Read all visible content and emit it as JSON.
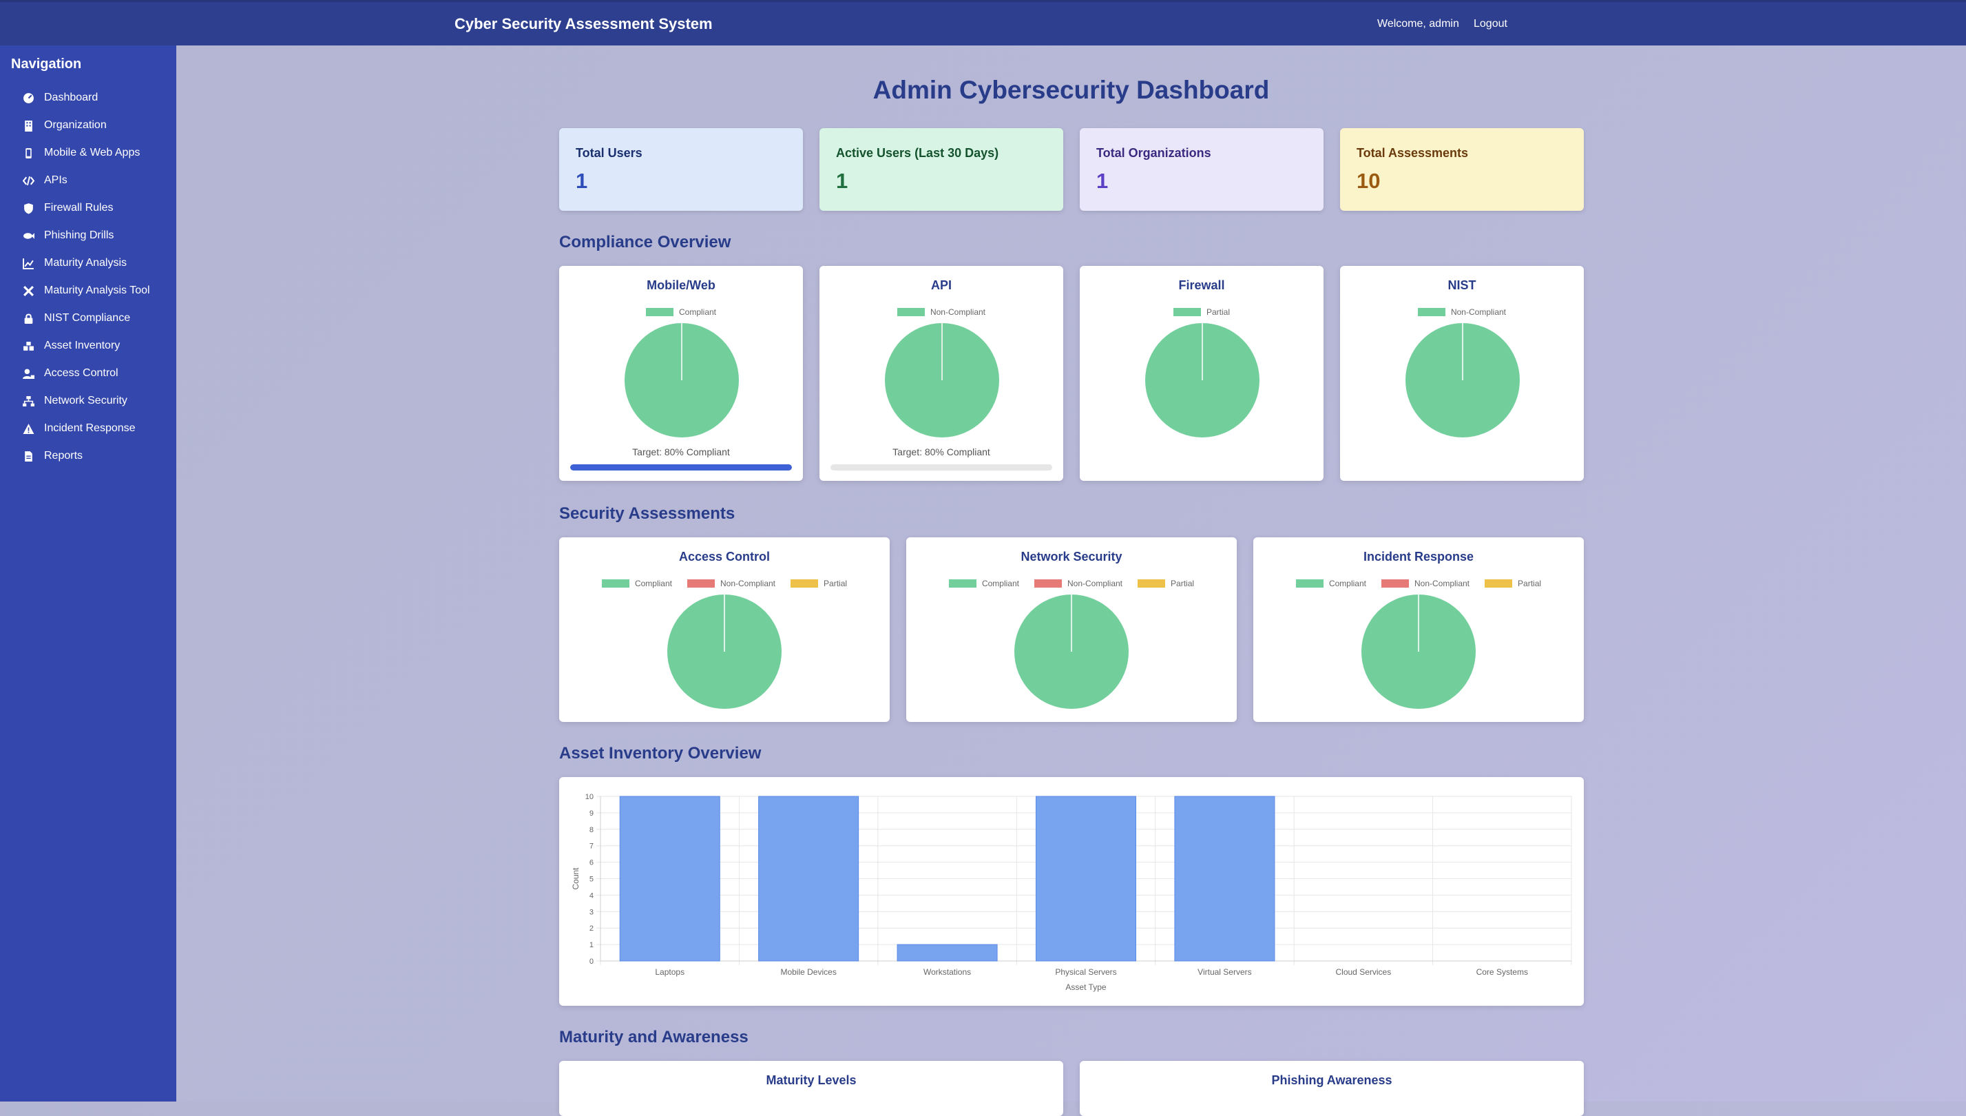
{
  "header": {
    "title": "Cyber Security Assessment System",
    "welcome": "Welcome, admin",
    "logout": "Logout"
  },
  "sidebar": {
    "heading": "Navigation",
    "items": [
      {
        "label": "Dashboard",
        "icon": "dashboard-icon"
      },
      {
        "label": "Organization",
        "icon": "building-icon"
      },
      {
        "label": "Mobile & Web Apps",
        "icon": "mobile-icon"
      },
      {
        "label": "APIs",
        "icon": "code-icon"
      },
      {
        "label": "Firewall Rules",
        "icon": "shield-icon"
      },
      {
        "label": "Phishing Drills",
        "icon": "fish-icon"
      },
      {
        "label": "Maturity Analysis",
        "icon": "line-chart-icon"
      },
      {
        "label": "Maturity Analysis Tool",
        "icon": "tools-icon"
      },
      {
        "label": "NIST Compliance",
        "icon": "lock-icon"
      },
      {
        "label": "Asset Inventory",
        "icon": "boxes-icon"
      },
      {
        "label": "Access Control",
        "icon": "user-lock-icon"
      },
      {
        "label": "Network Security",
        "icon": "network-icon"
      },
      {
        "label": "Incident Response",
        "icon": "warning-icon"
      },
      {
        "label": "Reports",
        "icon": "file-icon"
      }
    ]
  },
  "page": {
    "title": "Admin Cybersecurity Dashboard"
  },
  "stats": [
    {
      "label": "Total Users",
      "value": "1",
      "bg": "#dde8fb",
      "fg": "#1a2f6e",
      "vfg": "#2f4db8"
    },
    {
      "label": "Active Users (Last 30 Days)",
      "value": "1",
      "bg": "#d8f4e4",
      "fg": "#14532d",
      "vfg": "#1f6f3f"
    },
    {
      "label": "Total Organizations",
      "value": "1",
      "bg": "#ebe7fb",
      "fg": "#3b2a80",
      "vfg": "#5b3fc4"
    },
    {
      "label": "Total Assessments",
      "value": "10",
      "bg": "#fbf3c9",
      "fg": "#6a3a0c",
      "vfg": "#9a5a12"
    }
  ],
  "colors": {
    "compliant": "#72cf9c",
    "non_compliant": "#e57a76",
    "partial": "#edc14a",
    "bar": "#78a3ef",
    "progress": "#3e61d6"
  },
  "compliance": {
    "title": "Compliance Overview",
    "cards": [
      {
        "title": "Mobile/Web",
        "legend": [
          "Compliant"
        ],
        "target": "Target: 80% Compliant",
        "progress": 100
      },
      {
        "title": "API",
        "legend": [
          "Non-Compliant"
        ],
        "target": "Target: 80% Compliant",
        "progress": 0
      },
      {
        "title": "Firewall",
        "legend": [
          "Partial"
        ]
      },
      {
        "title": "NIST",
        "legend": [
          "Non-Compliant"
        ]
      }
    ]
  },
  "security": {
    "title": "Security Assessments",
    "legend": [
      "Compliant",
      "Non-Compliant",
      "Partial"
    ],
    "cards": [
      {
        "title": "Access Control"
      },
      {
        "title": "Network Security"
      },
      {
        "title": "Incident Response"
      }
    ]
  },
  "assets": {
    "title": "Asset Inventory Overview"
  },
  "chart_data": {
    "type": "bar",
    "categories": [
      "Laptops",
      "Mobile Devices",
      "Workstations",
      "Physical Servers",
      "Virtual Servers",
      "Cloud Services",
      "Core Systems"
    ],
    "values": [
      10,
      10,
      1,
      10,
      10,
      0,
      0
    ],
    "xlabel": "Asset Type",
    "ylabel": "Count",
    "ylim": [
      0,
      10
    ],
    "yticks": [
      0,
      1,
      2,
      3,
      4,
      5,
      6,
      7,
      8,
      9,
      10
    ],
    "grid": true
  },
  "maturity": {
    "title": "Maturity and Awareness",
    "cards": [
      {
        "title": "Maturity Levels"
      },
      {
        "title": "Phishing Awareness"
      }
    ]
  }
}
